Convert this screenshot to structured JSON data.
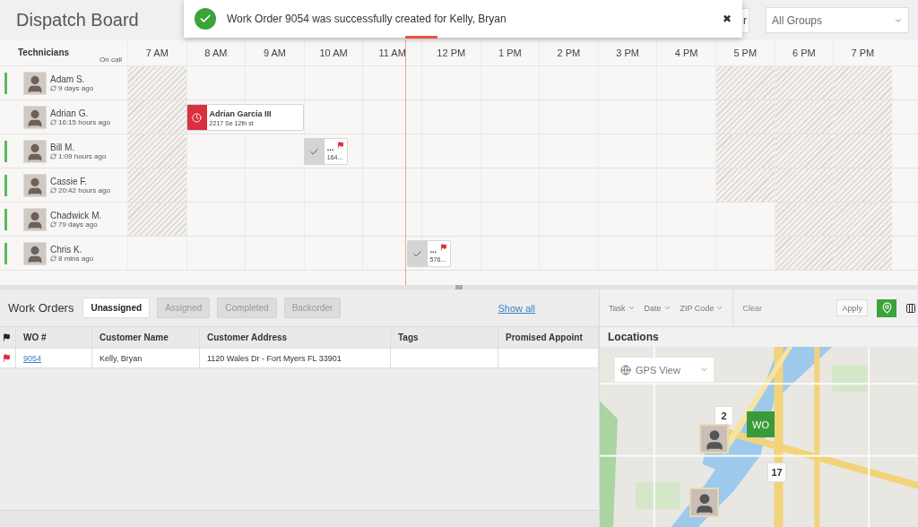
{
  "header": {
    "title": "Dispatch Board",
    "peek_button": "r",
    "group_select": "All Groups"
  },
  "toast": {
    "message": "Work Order 9054 was successfully created for Kelly, Bryan",
    "close": "✖"
  },
  "schedule": {
    "technicians_heading": "Technicians",
    "on_call_heading": "On call",
    "hours": [
      "7 AM",
      "8 AM",
      "9 AM",
      "10 AM",
      "11 AM",
      "12 PM",
      "1 PM",
      "2 PM",
      "3 PM",
      "4 PM",
      "5 PM",
      "6 PM",
      "7 PM"
    ],
    "technicians": [
      {
        "name": "Adam S.",
        "last_seen": "9 days ago",
        "on_call": true,
        "unavailable": [
          true,
          false,
          false,
          false,
          false,
          false,
          false,
          false,
          false,
          false,
          true,
          true,
          true
        ]
      },
      {
        "name": "Adrian G.",
        "last_seen": "16:15 hours ago",
        "on_call": false,
        "unavailable": [
          true,
          false,
          false,
          false,
          false,
          false,
          false,
          false,
          false,
          false,
          true,
          true,
          true
        ],
        "jobs": [
          {
            "kind": "alert",
            "title": "Adrian Garcia III",
            "subtitle": "2217 Se 12th st",
            "flagged": false
          }
        ]
      },
      {
        "name": "Bill M.",
        "last_seen": "1:09 hours ago",
        "on_call": true,
        "unavailable": [
          true,
          false,
          false,
          false,
          false,
          false,
          false,
          false,
          false,
          false,
          true,
          true,
          true
        ],
        "jobs": [
          {
            "kind": "done",
            "title": "...",
            "subtitle": "164...",
            "flagged": true
          }
        ]
      },
      {
        "name": "Cassie F.",
        "last_seen": "20:42 hours ago",
        "on_call": true,
        "unavailable": [
          true,
          false,
          false,
          false,
          false,
          false,
          false,
          false,
          false,
          false,
          true,
          true,
          true
        ]
      },
      {
        "name": "Chadwick M.",
        "last_seen": "79 days ago",
        "on_call": true,
        "unavailable": [
          true,
          false,
          false,
          false,
          false,
          false,
          false,
          false,
          false,
          false,
          false,
          true,
          true
        ]
      },
      {
        "name": "Chris K.",
        "last_seen": "8 mins ago",
        "on_call": true,
        "unavailable": [
          false,
          false,
          false,
          false,
          false,
          false,
          false,
          false,
          false,
          false,
          false,
          true,
          true
        ],
        "jobs": [
          {
            "kind": "done",
            "title": "...",
            "subtitle": "576...",
            "flagged": true
          }
        ]
      }
    ]
  },
  "work_orders": {
    "title": "Work Orders",
    "tabs": [
      {
        "label": "Unassigned",
        "selected": true
      },
      {
        "label": "Assigned",
        "selected": false
      },
      {
        "label": "Completed",
        "selected": false
      },
      {
        "label": "Backorder",
        "selected": false
      }
    ],
    "show_all": "Show all",
    "columns": [
      "WO #",
      "Customer Name",
      "Customer Address",
      "Tags",
      "Promised Appoint"
    ],
    "rows": [
      {
        "flagged": true,
        "cells": [
          "9054",
          "Kelly, Bryan",
          "1120 Wales Dr - Fort Myers FL 33901"
        ]
      }
    ]
  },
  "filters": {
    "dropdowns": [
      "Task",
      "Date",
      "ZIP Code"
    ],
    "clear": "Clear",
    "apply": "Apply"
  },
  "locations": {
    "title": "Locations",
    "view_select": "GPS View",
    "markers": [
      {
        "kind": "cluster",
        "label": "2"
      },
      {
        "kind": "work_order",
        "label": "WO"
      },
      {
        "kind": "cluster",
        "label": "17"
      },
      {
        "kind": "technician"
      },
      {
        "kind": "technician"
      }
    ]
  }
}
